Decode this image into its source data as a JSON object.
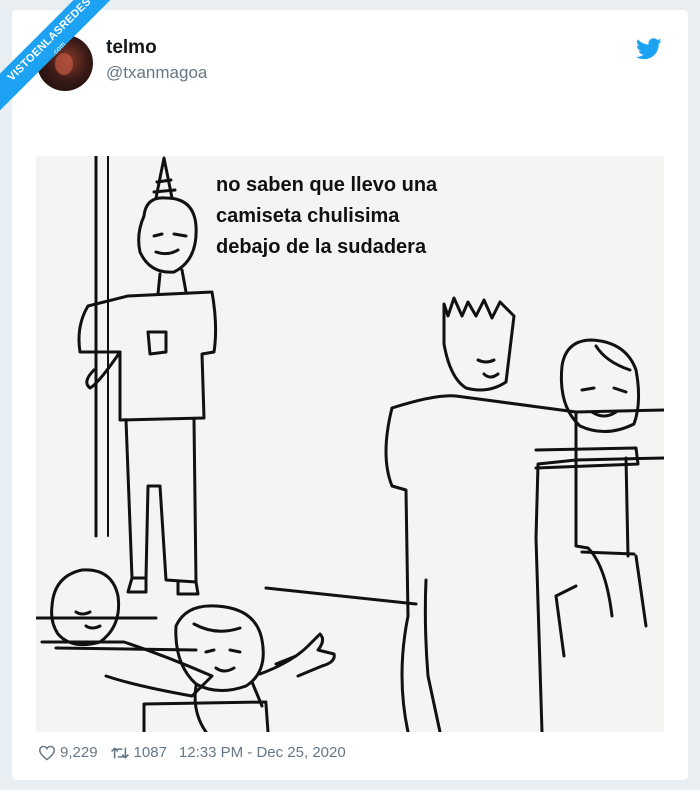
{
  "watermark": {
    "text": "VISTOENLASREDES",
    "sub": ".com"
  },
  "tweet": {
    "author_name": "telmo",
    "author_handle": "@txanmagoa",
    "caption_lines": [
      "no saben que llevo una",
      "camiseta chulisima",
      "debajo de la sudadera"
    ],
    "likes": "9,229",
    "retweets": "1087",
    "timestamp": "12:33 PM - Dec 25, 2020"
  },
  "icons": {
    "brand": "twitter-bird-icon",
    "like": "heart-icon",
    "retweet": "retweet-icon"
  },
  "colors": {
    "brand_blue": "#1da1f2",
    "page_bg": "#e9eef2",
    "muted_text": "#657786"
  }
}
